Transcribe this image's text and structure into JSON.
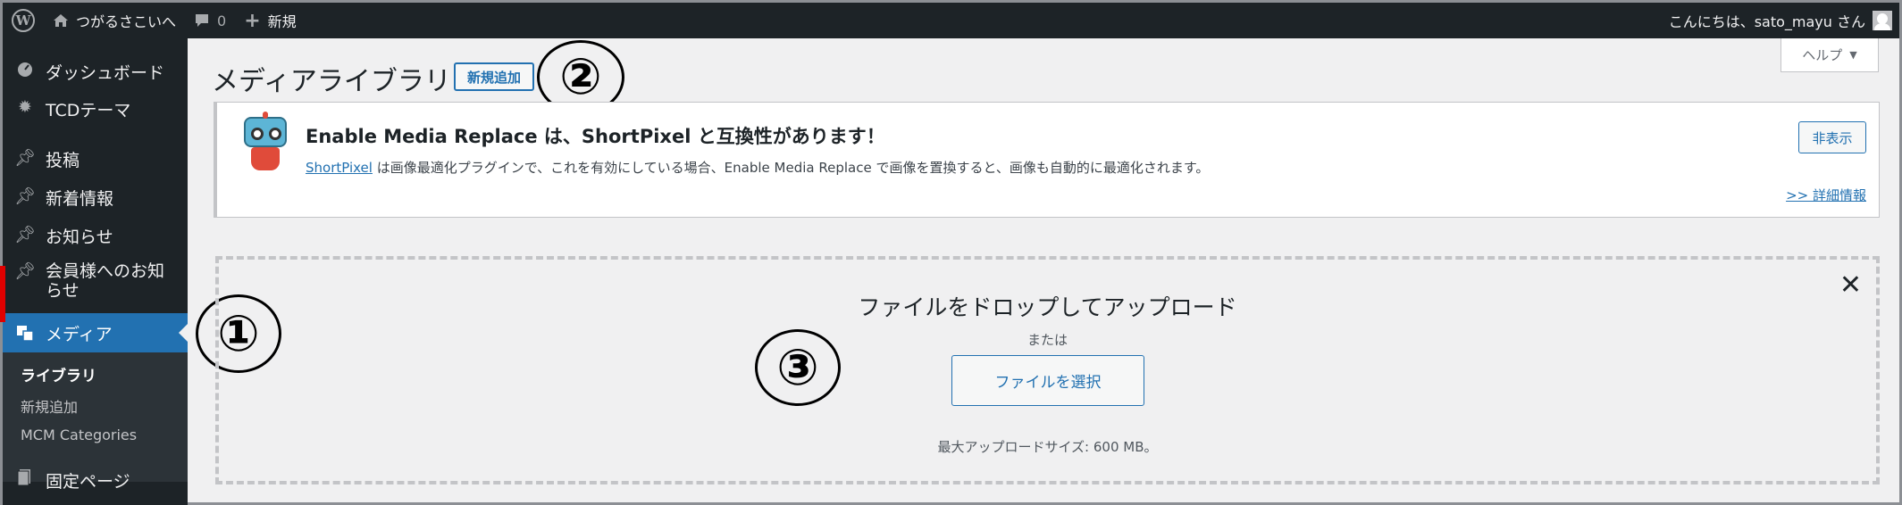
{
  "admin_bar": {
    "site_name": "つがるさこいへ",
    "comments_count": "0",
    "new_label": "新規",
    "greeting": "こんにちは、sato_mayu さん"
  },
  "sidebar": {
    "items": [
      {
        "label": "ダッシュボード",
        "icon": "dashboard-icon"
      },
      {
        "label": "TCDテーマ",
        "icon": "gear-icon"
      },
      {
        "label": "投稿",
        "icon": "pin-icon"
      },
      {
        "label": "新着情報",
        "icon": "pin-icon"
      },
      {
        "label": "お知らせ",
        "icon": "pin-icon"
      },
      {
        "label": "会員様へのお知らせ",
        "icon": "pin-icon"
      },
      {
        "label": "メディア",
        "icon": "media-icon",
        "current": true
      },
      {
        "label": "固定ページ",
        "icon": "page-icon"
      }
    ],
    "submenu": [
      {
        "label": "ライブラリ",
        "current": true
      },
      {
        "label": "新規追加"
      },
      {
        "label": "MCM Categories"
      }
    ]
  },
  "page": {
    "title": "メディアライブラリ",
    "add_new": "新規追加",
    "help": "ヘルプ"
  },
  "annotations": [
    "①",
    "②",
    "③"
  ],
  "notice": {
    "title": "Enable Media Replace は、ShortPixel と互換性があります！",
    "link_text": "ShortPixel",
    "body": " は画像最適化プラグインで、これを有効にしている場合、Enable Media Replace で画像を置換すると、画像も自動的に最適化されます。",
    "dismiss": "非表示",
    "details": ">> 詳細情報"
  },
  "uploader": {
    "drop_title": "ファイルをドロップしてアップロード",
    "or": "または",
    "select_button": "ファイルを選択",
    "max_size": "最大アップロードサイズ: 600 MB。"
  },
  "colors": {
    "admin_dark": "#1d2327",
    "accent": "#2271b1",
    "highlight": "#e00000"
  }
}
